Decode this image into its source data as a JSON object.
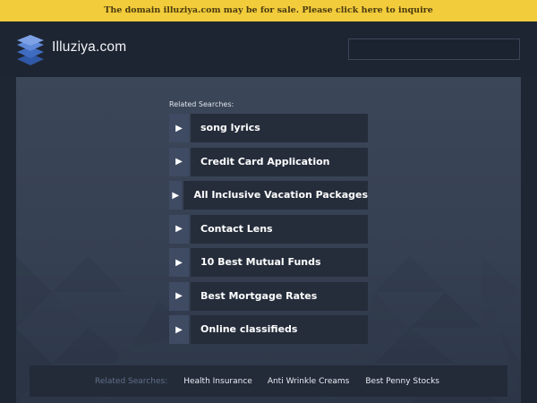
{
  "banner": {
    "text": "The domain illuziya.com may be for sale. Please click here to inquire",
    "color": "#f2cc3b"
  },
  "header": {
    "site_name": "Illuziya.com",
    "logo_icon": "stacked-layers-icon",
    "search_placeholder": ""
  },
  "main": {
    "related_label": "Related Searches:",
    "links": [
      {
        "label": "song lyrics"
      },
      {
        "label": "Credit Card Application"
      },
      {
        "label": "All Inclusive Vacation Packages"
      },
      {
        "label": "Contact Lens"
      },
      {
        "label": "10 Best Mutual Funds"
      },
      {
        "label": "Best Mortgage Rates"
      },
      {
        "label": "Online classifieds"
      }
    ]
  },
  "footer": {
    "label": "Related Searches:",
    "links": [
      {
        "label": "Health Insurance"
      },
      {
        "label": "Anti Wrinkle Creams"
      },
      {
        "label": "Best Penny Stocks"
      }
    ]
  }
}
